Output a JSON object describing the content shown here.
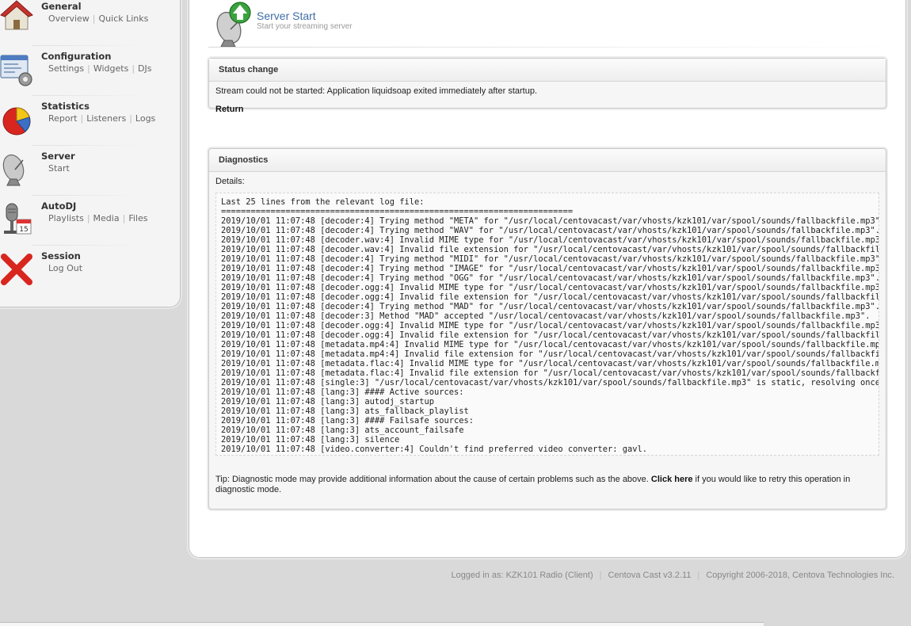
{
  "sidebar": {
    "groups": [
      {
        "title": "General",
        "icon": "house-icon",
        "links": [
          "Overview",
          "Quick Links"
        ]
      },
      {
        "title": "Configuration",
        "icon": "config-window-icon",
        "links": [
          "Settings",
          "Widgets",
          "DJs"
        ]
      },
      {
        "title": "Statistics",
        "icon": "pie-chart-icon",
        "links": [
          "Report",
          "Listeners",
          "Logs"
        ]
      },
      {
        "title": "Server",
        "icon": "satellite-dish-icon",
        "links": [
          "Start"
        ]
      },
      {
        "title": "AutoDJ",
        "icon": "microphone-calendar-icon",
        "links": [
          "Playlists",
          "Media",
          "Files"
        ]
      },
      {
        "title": "Session",
        "icon": "red-x-icon",
        "links": [
          "Log Out"
        ]
      }
    ]
  },
  "header": {
    "title": "Server Start",
    "subtitle": "Start your streaming server",
    "icon": "satellite-dish-up-arrow-icon"
  },
  "status": {
    "title": "Status change",
    "message": "Stream could not be started: Application liquidsoap exited immediately after startup.",
    "return_label": "Return"
  },
  "diagnostics": {
    "title": "Diagnostics",
    "details_label": "Details:",
    "log_text": "Last 25 lines from the relevant log file:\n=======================================================================\n2019/10/01 11:07:48 [decoder:4] Trying method \"META\" for \"/usr/local/centovacast/var/vhosts/kzk101/var/spool/sounds/fallbackfile.mp3\"...\n2019/10/01 11:07:48 [decoder:4] Trying method \"WAV\" for \"/usr/local/centovacast/var/vhosts/kzk101/var/spool/sounds/fallbackfile.mp3\"...\n2019/10/01 11:07:48 [decoder.wav:4] Invalid MIME type for \"/usr/local/centovacast/var/vhosts/kzk101/var/spool/sounds/fallbackfile.mp3\"\n2019/10/01 11:07:48 [decoder.wav:4] Invalid file extension for \"/usr/local/centovacast/var/vhosts/kzk101/var/spool/sounds/fallbackfile.mp3\"\n2019/10/01 11:07:48 [decoder:4] Trying method \"MIDI\" for \"/usr/local/centovacast/var/vhosts/kzk101/var/spool/sounds/fallbackfile.mp3\"...\n2019/10/01 11:07:48 [decoder:4] Trying method \"IMAGE\" for \"/usr/local/centovacast/var/vhosts/kzk101/var/spool/sounds/fallbackfile.mp3\"...\n2019/10/01 11:07:48 [decoder:4] Trying method \"OGG\" for \"/usr/local/centovacast/var/vhosts/kzk101/var/spool/sounds/fallbackfile.mp3\"...\n2019/10/01 11:07:48 [decoder.ogg:4] Invalid MIME type for \"/usr/local/centovacast/var/vhosts/kzk101/var/spool/sounds/fallbackfile.mp3\"\n2019/10/01 11:07:48 [decoder.ogg:4] Invalid file extension for \"/usr/local/centovacast/var/vhosts/kzk101/var/spool/sounds/fallbackfile.mp3\"\n2019/10/01 11:07:48 [decoder:4] Trying method \"MAD\" for \"/usr/local/centovacast/var/vhosts/kzk101/var/spool/sounds/fallbackfile.mp3\"...\n2019/10/01 11:07:48 [decoder:3] Method \"MAD\" accepted \"/usr/local/centovacast/var/vhosts/kzk101/var/spool/sounds/fallbackfile.mp3\".\n2019/10/01 11:07:48 [decoder.ogg:4] Invalid MIME type for \"/usr/local/centovacast/var/vhosts/kzk101/var/spool/sounds/fallbackfile.mp3\"\n2019/10/01 11:07:48 [decoder.ogg:4] Invalid file extension for \"/usr/local/centovacast/var/vhosts/kzk101/var/spool/sounds/fallbackfile.mp3\"\n2019/10/01 11:07:48 [metadata.mp4:4] Invalid MIME type for \"/usr/local/centovacast/var/vhosts/kzk101/var/spool/sounds/fallbackfile.mp3\"\n2019/10/01 11:07:48 [metadata.mp4:4] Invalid file extension for \"/usr/local/centovacast/var/vhosts/kzk101/var/spool/sounds/fallbackfile.mp3\"\n2019/10/01 11:07:48 [metadata.flac:4] Invalid MIME type for \"/usr/local/centovacast/var/vhosts/kzk101/var/spool/sounds/fallbackfile.mp3\"\n2019/10/01 11:07:48 [metadata.flac:4] Invalid file extension for \"/usr/local/centovacast/var/vhosts/kzk101/var/spool/sounds/fallbackfile.mp3\"\n2019/10/01 11:07:48 [single:3] \"/usr/local/centovacast/var/vhosts/kzk101/var/spool/sounds/fallbackfile.mp3\" is static, resolving once for all...\n2019/10/01 11:07:48 [lang:3] #### Active sources:\n2019/10/01 11:07:48 [lang:3] autodj_startup\n2019/10/01 11:07:48 [lang:3] ats_fallback_playlist\n2019/10/01 11:07:48 [lang:3] #### Failsafe sources:\n2019/10/01 11:07:48 [lang:3] ats_account_failsafe\n2019/10/01 11:07:48 [lang:3] silence\n2019/10/01 11:07:48 [video.converter:4] Couldn't find preferred video converter: gavl.",
    "tip_before": "Tip: Diagnostic mode may provide additional information about the cause of certain problems such as the above. ",
    "tip_link": "Click here",
    "tip_after": " if you would like to retry this operation in diagnostic mode."
  },
  "footer": {
    "logged_in": "Logged in as: KZK101 Radio (Client)",
    "version": "Centova Cast v3.2.11",
    "copyright": "Copyright 2006-2018, Centova Technologies Inc."
  }
}
